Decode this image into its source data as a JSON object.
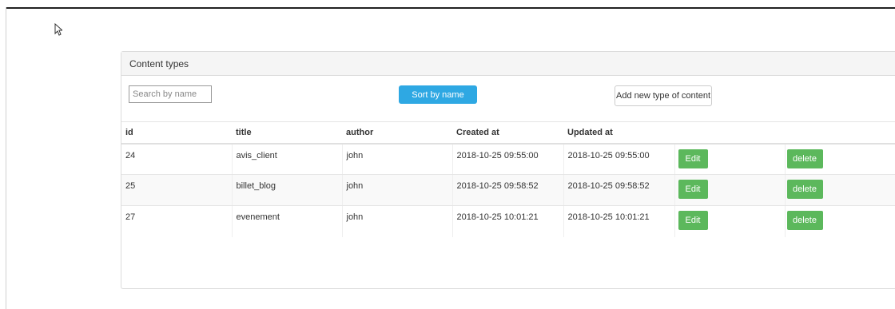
{
  "panel": {
    "title": "Content types"
  },
  "toolbar": {
    "search_placeholder": "Search by name",
    "search_value": "",
    "sort_label": "Sort by name",
    "add_label": "Add new type of content"
  },
  "table": {
    "headers": [
      "id",
      "title",
      "author",
      "Created at",
      "Updated at",
      "",
      ""
    ],
    "rows": [
      {
        "id": "24",
        "title": "avis_client",
        "author": "john",
        "created": "2018-10-25 09:55:00",
        "updated": "2018-10-25 09:55:00",
        "edit": "Edit",
        "delete": "delete"
      },
      {
        "id": "25",
        "title": "billet_blog",
        "author": "john",
        "created": "2018-10-25 09:58:52",
        "updated": "2018-10-25 09:58:52",
        "edit": "Edit",
        "delete": "delete"
      },
      {
        "id": "27",
        "title": "evenement",
        "author": "john",
        "created": "2018-10-25 10:01:21",
        "updated": "2018-10-25 10:01:21",
        "edit": "Edit",
        "delete": "delete"
      }
    ]
  },
  "colors": {
    "accent": "#2ea8e3",
    "success": "#5cb85c",
    "panel_heading": "#f5f5f5"
  },
  "icons": {
    "cursor": "mouse-pointer-icon"
  }
}
